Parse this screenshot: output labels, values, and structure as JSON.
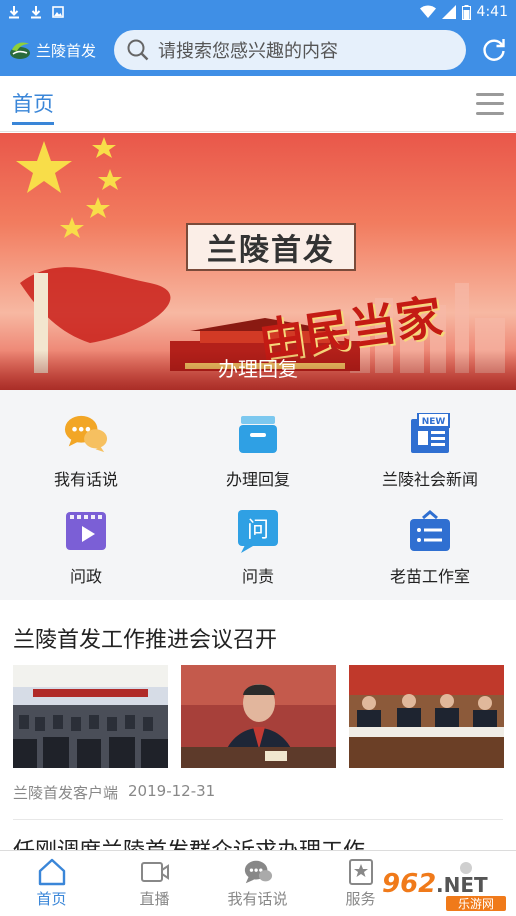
{
  "status_bar": {
    "time": "4:41"
  },
  "header": {
    "app_name": "兰陵首发",
    "search_placeholder": "请搜索您感兴趣的内容"
  },
  "tabs": {
    "home": "首页"
  },
  "banner": {
    "title": "兰陵首发",
    "slogan": "由民当家",
    "caption": "办理回复"
  },
  "grid": [
    {
      "label": "我有话说",
      "icon": "chat-bubbles-icon",
      "color": "#f2a626"
    },
    {
      "label": "办理回复",
      "icon": "reply-box-icon",
      "color": "#2fa0e4"
    },
    {
      "label": "兰陵社会新闻",
      "icon": "newspaper-icon",
      "color": "#2f6fd1"
    },
    {
      "label": "问政",
      "icon": "video-play-icon",
      "color": "#7b5fd6"
    },
    {
      "label": "问责",
      "icon": "question-bubble-icon",
      "color": "#2fa0e4"
    },
    {
      "label": "老苗工作室",
      "icon": "briefcase-list-icon",
      "color": "#2f6fd1"
    }
  ],
  "news": [
    {
      "title": "兰陵首发工作推进会议召开",
      "source": "兰陵首发客户端",
      "date": "2019-12-31"
    },
    {
      "title": "任刚调度兰陵首发群众诉求办理工作"
    }
  ],
  "bottom_nav": [
    {
      "label": "首页",
      "icon": "home-icon",
      "active": true
    },
    {
      "label": "直播",
      "icon": "video-camera-icon"
    },
    {
      "label": "我有话说",
      "icon": "chat-icon"
    },
    {
      "label": "服务",
      "icon": "star-doc-icon"
    }
  ],
  "watermark": {
    "text": "962.NET",
    "subtext": "乐游网"
  },
  "colors": {
    "primary": "#3f8fe6",
    "tab_active": "#3a86d8",
    "grid_bg": "#f4f5f7"
  }
}
